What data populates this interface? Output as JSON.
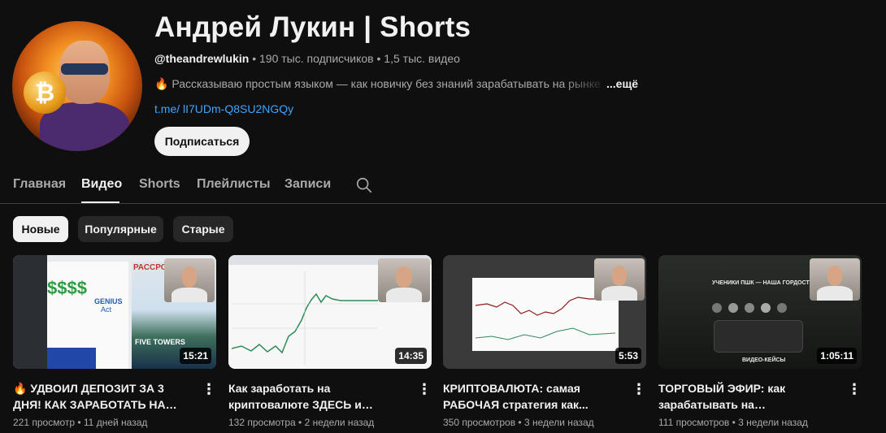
{
  "channel": {
    "title": "Андрей Лукин | Shorts",
    "handle": "@theandrewlukin",
    "stats": " • 190 тыс. подписчиков • 1,5 тыс. видео",
    "description": "🔥 Рассказываю простым языком — как новичку без знаний зарабатывать на рынке",
    "more_label": "...ещё",
    "link": "t.me/ lI7UDm-Q8SU2NGQy",
    "subscribe_label": "Подписаться"
  },
  "tabs": [
    {
      "label": "Главная",
      "active": false
    },
    {
      "label": "Видео",
      "active": true
    },
    {
      "label": "Shorts",
      "active": false
    },
    {
      "label": "Плейлисты",
      "active": false
    },
    {
      "label": "Записи",
      "active": false
    }
  ],
  "chips": [
    {
      "label": "Новые",
      "active": true
    },
    {
      "label": "Популярные",
      "active": false
    },
    {
      "label": "Старые",
      "active": false
    }
  ],
  "videos": [
    {
      "title": "🔥 УДВОИЛ ДЕПОЗИТ ЗА 3 ДНЯ! КАК ЗАРАБОТАТЬ НА КРИПТЕ...",
      "duration": "15:21",
      "meta": "221 просмотр • 11 дней назад"
    },
    {
      "title": "Как заработать на криптовалюте ЗДЕСЬ и СЕЙЧАС даже с нуля и...",
      "duration": "14:35",
      "meta": "132 просмотра • 2 недели назад"
    },
    {
      "title": "КРИПТОВАЛЮТА: самая РАБОЧАЯ стратегия как...",
      "duration": "5:53",
      "meta": "350 просмотров • 3 недели назад"
    },
    {
      "title": "ТОРГОВЫЙ ЭФИР: как зарабатывать на криптовалюте...",
      "duration": "1:05:11",
      "meta": "111 просмотров • 3 недели назад"
    }
  ],
  "thumb_text": {
    "v1_genius": "GENIUS",
    "v1_act": "Act",
    "v1_dollars": "$$$$",
    "v1_banner": "РАССРОЧКА",
    "v1_towers": "FIVE TOWERS",
    "v4_header": "УЧЕНИКИ ПШК — НАША ГОРДОСТЬ",
    "v4_footer": "ВИДЕО-КЕЙСЫ"
  },
  "colors": {
    "background": "#0f0f0f",
    "link": "#3ea6ff",
    "chip_bg": "#272727",
    "muted_text": "#aaaaaa"
  },
  "icons": {
    "search": "search-icon",
    "more": "more-vert-icon"
  }
}
